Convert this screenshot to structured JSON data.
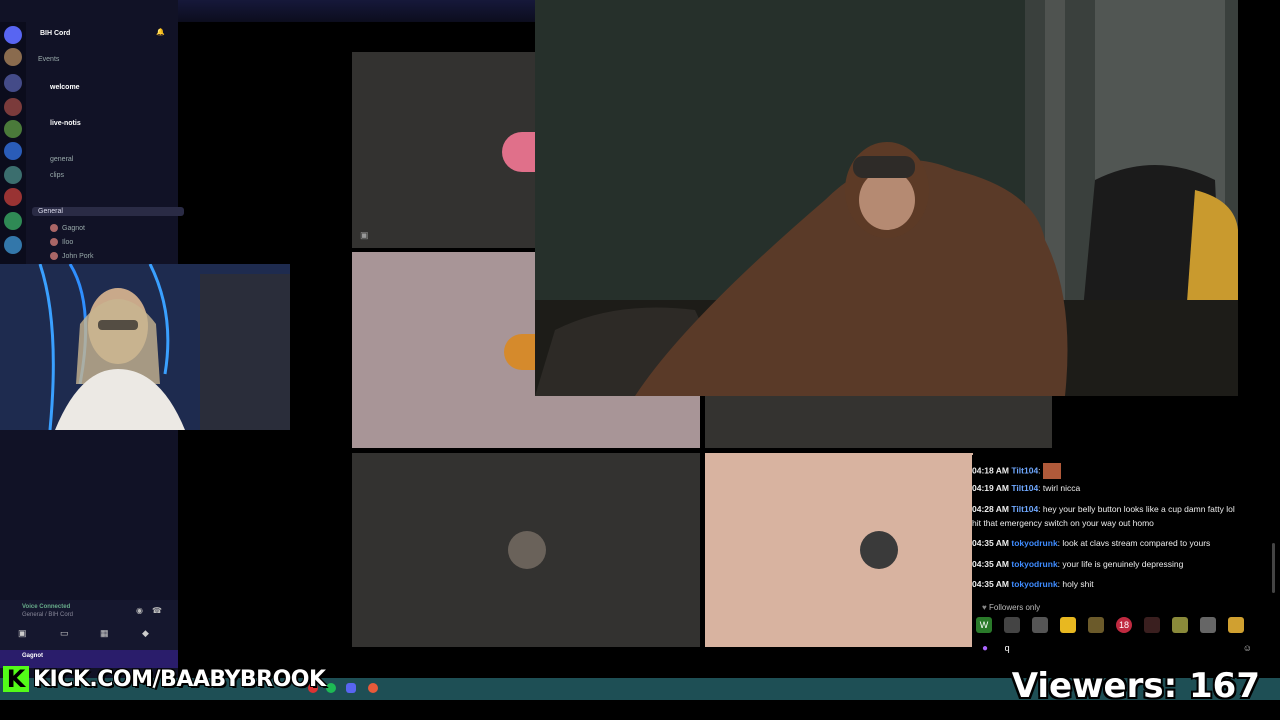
{
  "discord": {
    "server_name": "BIH Cord",
    "events_label": "Events",
    "channels": [
      {
        "name": "welcome"
      },
      {
        "name": "live-notis"
      },
      {
        "name": "general"
      },
      {
        "name": "clips"
      }
    ],
    "voice_channel": "General",
    "voice_users": [
      "Gagnot",
      "Iloo",
      "John Pork"
    ],
    "voice_status": "Voice Connected",
    "voice_sub": "General / BIH Cord",
    "user_name": "Gagnot"
  },
  "chat": {
    "messages": [
      {
        "time": "04:18 AM",
        "user": "Tilt104",
        "text": "",
        "user_color": "#6fa8ff"
      },
      {
        "time": "04:19 AM",
        "user": "Tilt104",
        "text": "twirl nicca",
        "user_color": "#6fa8ff"
      },
      {
        "time": "04:28 AM",
        "user": "Tilt104",
        "text": "hey your belly button looks like a cup damn fatty lol",
        "user_color": "#6fa8ff"
      },
      {
        "time": "",
        "user": "",
        "text": "hit that emergency switch on your way out homo",
        "user_color": "#6fa8ff"
      },
      {
        "time": "04:35 AM",
        "user": "tokyodrunk",
        "text": "look at clavs stream compared to yours",
        "user_color": "#3f8cff"
      },
      {
        "time": "04:35 AM",
        "user": "tokyodrunk",
        "text": "your life is genuinely depressing",
        "user_color": "#3f8cff"
      },
      {
        "time": "04:35 AM",
        "user": "tokyodrunk",
        "text": "holy shit",
        "user_color": "#3f8cff"
      }
    ],
    "followers_only": "Followers only",
    "input_value": "q"
  },
  "overlay": {
    "kick_logo": "K",
    "kick_url": "KICK.COM/BAABYBROOK",
    "viewers": "Viewers: 167"
  },
  "colors": {
    "kick_green": "#53fc18",
    "discord_bg": "#111226",
    "taskbar": "#1e4f55"
  }
}
